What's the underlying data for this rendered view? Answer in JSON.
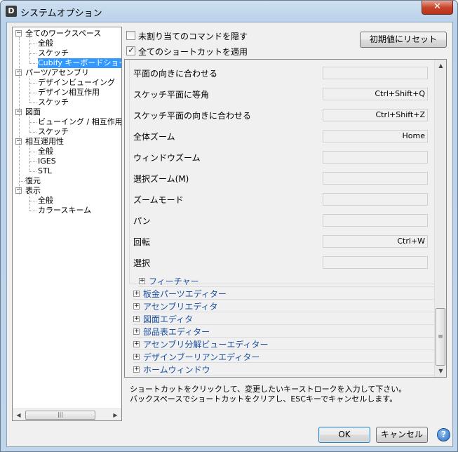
{
  "window": {
    "title": "システムオプション",
    "app_icon_letter": "D",
    "close_symbol": "✕"
  },
  "tree": {
    "items": [
      {
        "label": "全てのワークスペース",
        "level": 0,
        "expander": "−"
      },
      {
        "label": "全般",
        "level": 1
      },
      {
        "label": "スケッチ",
        "level": 1
      },
      {
        "label": "Cubify キーボードショートカット",
        "level": 1,
        "selected": true
      },
      {
        "label": "パーツ/アセンブリ",
        "level": 0,
        "expander": "−"
      },
      {
        "label": "デザインビューイング",
        "level": 1
      },
      {
        "label": "デザイン相互作用",
        "level": 1
      },
      {
        "label": "スケッチ",
        "level": 1
      },
      {
        "label": "図面",
        "level": 0,
        "expander": "−"
      },
      {
        "label": "ビューイング / 相互作用",
        "level": 1
      },
      {
        "label": "スケッチ",
        "level": 1
      },
      {
        "label": "相互運用性",
        "level": 0,
        "expander": "−"
      },
      {
        "label": "全般",
        "level": 1
      },
      {
        "label": "IGES",
        "level": 1
      },
      {
        "label": "STL",
        "level": 1
      },
      {
        "label": "復元",
        "level": 0
      },
      {
        "label": "表示",
        "level": 0,
        "expander": "−"
      },
      {
        "label": "全般",
        "level": 1
      },
      {
        "label": "カラースキーム",
        "level": 1
      }
    ],
    "scroll_thumb_glyph": "|||",
    "scroll_left": "◀",
    "scroll_right": "▶"
  },
  "options": {
    "hide_unassigned_label": "未割り当てのコマンドを隠す",
    "hide_unassigned_checked": false,
    "apply_all_label": "全てのショートカットを適用",
    "apply_all_checked": true,
    "reset_label": "初期値にリセット"
  },
  "shortcuts": [
    {
      "command": "平面の向きに合わせる",
      "key": ""
    },
    {
      "command": "スケッチ平面に等角",
      "key": "Ctrl+Shift+Q"
    },
    {
      "command": "スケッチ平面の向きに合わせる",
      "key": "Ctrl+Shift+Z"
    },
    {
      "command": "全体ズーム",
      "key": "Home"
    },
    {
      "command": "ウィンドウズーム",
      "key": ""
    },
    {
      "command": "選択ズーム(M)",
      "key": ""
    },
    {
      "command": "ズームモード",
      "key": ""
    },
    {
      "command": "パン",
      "key": ""
    },
    {
      "command": "回転",
      "key": "Ctrl+W"
    },
    {
      "command": "選択",
      "key": ""
    }
  ],
  "sections": [
    {
      "label": "フィーチャー",
      "indent": true
    },
    {
      "label": "板金パーツエディター"
    },
    {
      "label": "アセンブリエディタ"
    },
    {
      "label": "図面エディタ"
    },
    {
      "label": "部品表エディター"
    },
    {
      "label": "アセンブリ分解ビューエディター"
    },
    {
      "label": "デザインブーリアンエディター"
    },
    {
      "label": "ホームウィンドウ"
    }
  ],
  "section_expander": "+",
  "panel_scroll": {
    "up": "▲",
    "down": "▼",
    "thumb_glyph": "≡"
  },
  "hint": {
    "line1": "ショートカットをクリックして、変更したいキーストロークを入力して下さい。",
    "line2": "バックスペースでショートカットをクリアし、ESCキーでキャンセルします。"
  },
  "footer": {
    "ok_label": "OK",
    "cancel_label": "キャンセル",
    "help_symbol": "?"
  },
  "colors": {
    "selection": "#3399ff",
    "section_link": "#1a4fa0",
    "title_gradient": "#b9d1ea"
  }
}
